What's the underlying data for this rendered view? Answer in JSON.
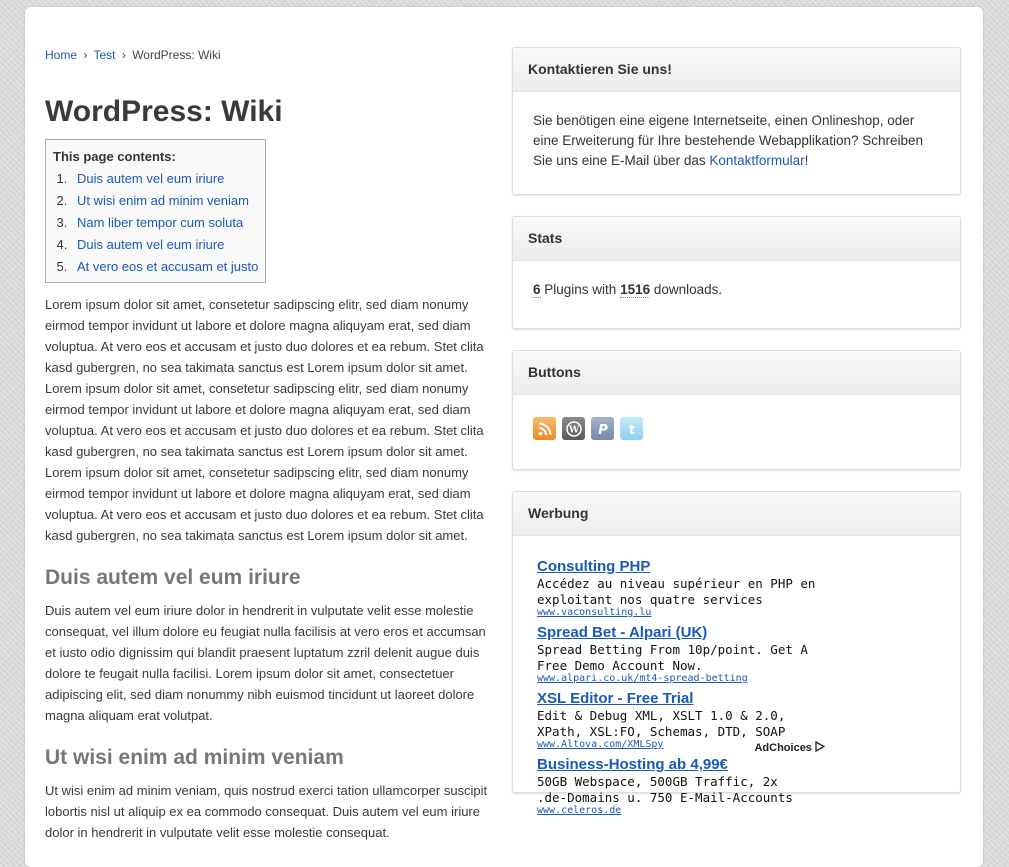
{
  "breadcrumb": {
    "home": "Home",
    "sep1": "›",
    "test": "Test",
    "sep2": "›",
    "current": "WordPress: Wiki"
  },
  "page_title": "WordPress: Wiki",
  "toc": {
    "title": "This page contents:",
    "items": [
      "Duis autem vel eum iriure",
      "Ut wisi enim ad minim veniam",
      "Nam liber tempor cum soluta",
      "Duis autem vel eum iriure",
      "At vero eos et accusam et justo"
    ]
  },
  "content": {
    "intro": "Lorem ipsum dolor sit amet, consetetur sadipscing elitr, sed diam nonumy eirmod tempor invidunt ut labore et dolore magna aliquyam erat, sed diam voluptua. At vero eos et accusam et justo duo dolores et ea rebum. Stet clita kasd gubergren, no sea takimata sanctus est Lorem ipsum dolor sit amet. Lorem ipsum dolor sit amet, consetetur sadipscing elitr, sed diam nonumy eirmod tempor invidunt ut labore et dolore magna aliquyam erat, sed diam voluptua. At vero eos et accusam et justo duo dolores et ea rebum. Stet clita kasd gubergren, no sea takimata sanctus est Lorem ipsum dolor sit amet. Lorem ipsum dolor sit amet, consetetur sadipscing elitr, sed diam nonumy eirmod tempor invidunt ut labore et dolore magna aliquyam erat, sed diam voluptua. At vero eos et accusam et justo duo dolores et ea rebum. Stet clita kasd gubergren, no sea takimata sanctus est Lorem ipsum dolor sit amet.",
    "section1_heading": "Duis autem vel eum iriure",
    "section1_text": "Duis autem vel eum iriure dolor in hendrerit in vulputate velit esse molestie consequat, vel illum dolore eu feugiat nulla facilisis at vero eros et accumsan et iusto odio dignissim qui blandit praesent luptatum zzril delenit augue duis dolore te feugait nulla facilisi. Lorem ipsum dolor sit amet, consectetuer adipiscing elit, sed diam nonummy nibh euismod tincidunt ut laoreet dolore magna aliquam erat volutpat.",
    "section2_heading": "Ut wisi enim ad minim veniam",
    "section2_text": "Ut wisi enim ad minim veniam, quis nostrud exerci tation ullamcorper suscipit lobortis nisl ut aliquip ex ea commodo consequat. Duis autem vel eum iriure dolor in hendrerit in vulputate velit esse molestie consequat."
  },
  "sidebar": {
    "contact": {
      "title": "Kontaktieren Sie uns!",
      "text": "Sie benötigen eine eigene Internetseite, einen Onlineshop, oder eine Erweiterung für Ihre bestehende Webapplikation? Schreiben Sie uns eine E-Mail über das ",
      "link": "Kontaktformular",
      "suffix": "!"
    },
    "stats": {
      "title": "Stats",
      "plugins_count": "6",
      "plugins_label": " Plugins with ",
      "downloads_count": "1516",
      "downloads_label": " downloads."
    },
    "buttons": {
      "title": "Buttons",
      "icons": [
        "rss-icon",
        "wordpress-icon",
        "paypal-icon",
        "twitter-icon"
      ]
    },
    "ads": {
      "title": "Werbung",
      "items": [
        {
          "title": "Consulting PHP",
          "text": "Accédez au niveau supérieur en PHP en exploitant nos quatre services",
          "url": "www.vaconsulting.lu"
        },
        {
          "title": "Spread Bet - Alpari (UK)",
          "text": "Spread Betting From 10p/point. Get A Free Demo Account Now.",
          "url": "www.alpari.co.uk/mt4-spread-betting"
        },
        {
          "title": "XSL Editor - Free Trial",
          "text": "Edit & Debug XML, XSLT 1.0 & 2.0, XPath, XSL:FO, Schemas, DTD, SOAP",
          "url": "www.Altova.com/XMLSpy"
        },
        {
          "title": "Business-Hosting ab 4,99€",
          "text": "50GB Webspace, 500GB Traffic, 2x .de-Domains u. 750 E-Mail-Accounts",
          "url": "www.celeros.de"
        }
      ],
      "adchoices": "AdChoices"
    }
  }
}
